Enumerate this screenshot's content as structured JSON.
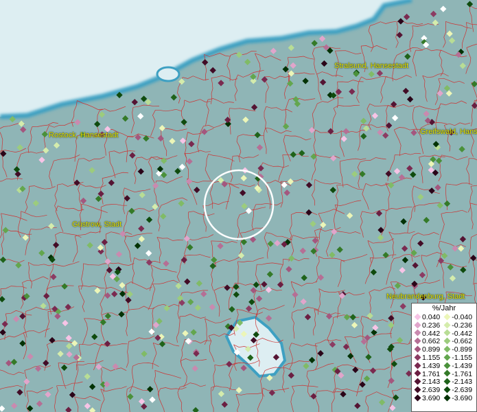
{
  "map": {
    "cities": [
      {
        "name": "Stralsund, Hansestadt"
      },
      {
        "name": "Rostock, Hansestadt"
      },
      {
        "name": "Greifswald, Hanse"
      },
      {
        "name": "Güstrow, Stadt"
      },
      {
        "name": "Neubrandenburg, Stadt"
      }
    ]
  },
  "legend": {
    "title": "%/Jahr",
    "positive": [
      "0.040",
      "0.236",
      "0.442",
      "0.662",
      "0.899",
      "1.155",
      "1.439",
      "1.761",
      "2.143",
      "2.639",
      "3.690"
    ],
    "negative": [
      "-0.040",
      "-0.236",
      "-0.442",
      "-0.662",
      "-0.899",
      "-1.155",
      "-1.439",
      "-1.761",
      "-2.143",
      "-2.639",
      "-3.690"
    ],
    "positive_colors": [
      "#f6c4e6",
      "#e1a5cb",
      "#c98aaf",
      "#b56f95",
      "#a4577e",
      "#8c3c63",
      "#7a2a50",
      "#6b1f42",
      "#541433",
      "#420c26",
      "#2a0418"
    ],
    "negative_colors": [
      "#ecf6b8",
      "#d4ecac",
      "#b8dd95",
      "#9ccc7d",
      "#80bb66",
      "#63a64e",
      "#4a913a",
      "#347a28",
      "#1f631a",
      "#0f4b0e",
      "#033205"
    ]
  },
  "colors": {
    "sea": "#ddeef2",
    "land": "#8fb5b6",
    "coast": "#3ea0c2",
    "borders": "#cc3333",
    "selection_ring": "#ffffff"
  }
}
